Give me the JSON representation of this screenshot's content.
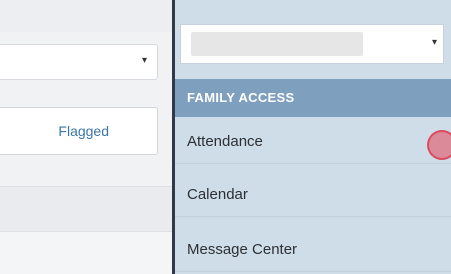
{
  "left": {
    "flagged_label": "Flagged",
    "select_caret": "▾"
  },
  "right": {
    "top_select_caret": "▾",
    "section_header": "FAMILY ACCESS",
    "items": [
      {
        "label": "Attendance"
      },
      {
        "label": "Calendar"
      },
      {
        "label": "Message Center"
      }
    ]
  },
  "colors": {
    "menu_background": "#cfdde8",
    "section_header_bg": "#7f9fbe",
    "divider": "#2f3a48",
    "link_blue": "#3a78a8",
    "cursor_highlight": "#e6465a"
  }
}
